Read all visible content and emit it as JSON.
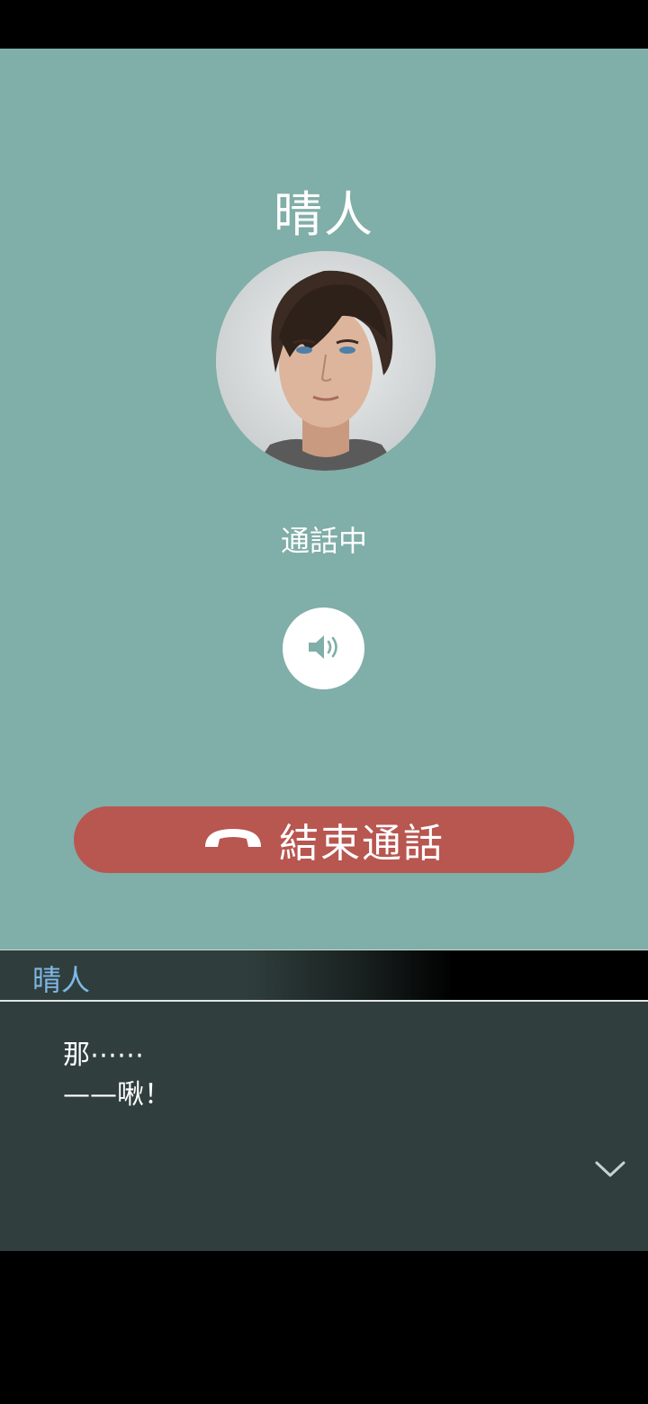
{
  "call": {
    "caller_name": "晴人",
    "status": "通話中",
    "end_call_label": "結束通話"
  },
  "icons": {
    "speaker": "speaker-icon",
    "hangup": "phone-hangup-icon",
    "next": "chevron-down-icon"
  },
  "dialogue": {
    "speaker": "晴人",
    "lines": [
      "那⋯⋯",
      "——啾！"
    ]
  },
  "colors": {
    "call_background": "#80aea8",
    "end_call_button": "#b85650",
    "dialogue_background": "#303e3d",
    "speaker_name": "#7fb7e6"
  }
}
